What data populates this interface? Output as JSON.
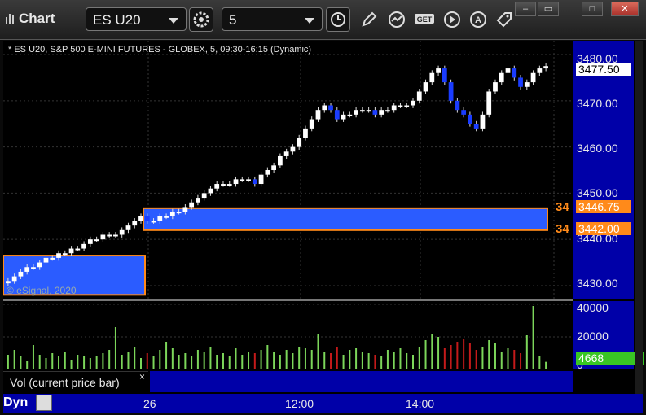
{
  "window": {
    "title": "Chart",
    "buttons": [
      "–",
      "▭",
      "□",
      "✕"
    ]
  },
  "toolbar": {
    "symbol": "ES U20",
    "interval": "5",
    "icons": [
      "settings-icon",
      "clock-icon",
      "draw-icon",
      "studies-icon",
      "get-icon",
      "play-icon",
      "analytics-icon",
      "tag-icon"
    ]
  },
  "chart": {
    "info": "* ES U20, S&P 500 E-MINI FUTURES - GLOBEX, 5, 09:30-16:15 (Dynamic)",
    "watermark": "© eSignal, 2020",
    "price_labels": [
      "3480.00",
      "3470.00",
      "3460.00",
      "3450.00",
      "3440.00",
      "3430.00"
    ],
    "last_price": "3477.50",
    "zone_upper": "3446.75",
    "zone_lower": "3442.00",
    "zone_marker_left": "34",
    "colors": {
      "up": "#ffffff",
      "down": "#1a3cff",
      "zone": "#2b5cff",
      "zone_border": "#ff8a1a",
      "axis": "#0000a8",
      "volume_up": "#7cd65a",
      "volume_down": "#c41a1a"
    }
  },
  "volume": {
    "title": "Vol (current price bar)",
    "labels": [
      "40000",
      "20000",
      "0"
    ],
    "current": "4668",
    "close_label": "×"
  },
  "xaxis": {
    "labels": [
      "26",
      "12:00",
      "14:00"
    ],
    "mode": "Dyn"
  },
  "chart_data": {
    "type": "candlestick",
    "ylim": [
      3427,
      3483
    ],
    "series": [
      {
        "name": "price",
        "values": [
          3431,
          3432,
          3433,
          3434,
          3434,
          3435,
          3436,
          3436,
          3437,
          3437,
          3438,
          3438,
          3439,
          3440,
          3440,
          3441,
          3441,
          3441,
          3442,
          3443,
          3444,
          3445,
          3444,
          3444,
          3445,
          3445,
          3446,
          3446,
          3447,
          3448,
          3449,
          3450,
          3451,
          3452,
          3452,
          3452,
          3453,
          3453,
          3453,
          3452,
          3454,
          3455,
          3456,
          3458,
          3459,
          3460,
          3462,
          3464,
          3466,
          3468,
          3469,
          3468,
          3466,
          3467,
          3467,
          3468,
          3468,
          3468,
          3467,
          3468,
          3468,
          3469,
          3469,
          3469,
          3470,
          3472,
          3474,
          3476,
          3477,
          3474,
          3470,
          3468,
          3467,
          3465,
          3464,
          3467,
          3472,
          3474,
          3476,
          3477,
          3475,
          3473,
          3474,
          3476,
          3477,
          3477.5
        ]
      }
    ],
    "volume": [
      9000,
      12000,
      8000,
      5000,
      15000,
      9000,
      7000,
      10000,
      8000,
      11000,
      6000,
      9000,
      8000,
      7000,
      8000,
      10000,
      12000,
      26000,
      9000,
      11000,
      14000,
      7000,
      10000,
      8000,
      12000,
      17000,
      13000,
      9000,
      10000,
      8000,
      12000,
      11000,
      14000,
      9000,
      10000,
      8000,
      13000,
      9000,
      11000,
      10000,
      12000,
      15000,
      11000,
      9000,
      12000,
      10000,
      14000,
      13000,
      12000,
      22000,
      11000,
      10000,
      14000,
      9000,
      12000,
      13000,
      11000,
      10000,
      9000,
      8000,
      12000,
      11000,
      13000,
      10000,
      9000,
      14000,
      18000,
      22000,
      20000,
      13000,
      15000,
      17000,
      19000,
      16000,
      12000,
      14000,
      18000,
      16000,
      11000,
      13000,
      12000,
      10000,
      21000,
      39000,
      8000,
      4668
    ]
  }
}
